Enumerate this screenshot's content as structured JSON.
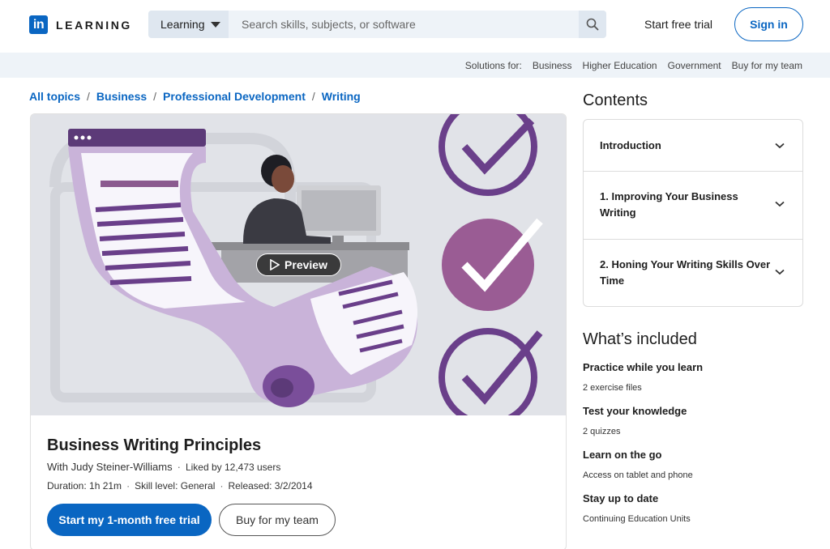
{
  "brand": {
    "logo_mark": "in",
    "logo_word": "LEARNING",
    "accent": "#0a66c2"
  },
  "search": {
    "category": "Learning",
    "placeholder": "Search skills, subjects, or software",
    "icon": "search-icon"
  },
  "header": {
    "start_trial": "Start free trial",
    "sign_in": "Sign in"
  },
  "solutions": {
    "label": "Solutions for:",
    "items": [
      "Business",
      "Higher Education",
      "Government",
      "Buy for my team"
    ]
  },
  "breadcrumb": [
    "All topics",
    "Business",
    "Professional Development",
    "Writing"
  ],
  "course": {
    "preview_label": "Preview",
    "title": "Business Writing Principles",
    "author": "With Judy Steiner-Williams",
    "likes": "Liked by 12,473 users",
    "duration": "Duration: 1h 21m",
    "skill": "Skill level: General",
    "released": "Released: 3/2/2014",
    "cta_primary": "Start my 1-month free trial",
    "cta_secondary": "Buy for my team"
  },
  "contents": {
    "title": "Contents",
    "chapters": [
      "Introduction",
      "1. Improving Your Business Writing",
      "2. Honing Your Writing Skills Over Time"
    ]
  },
  "included": {
    "title": "What’s included",
    "items": [
      {
        "heading": "Practice while you learn",
        "detail": "2 exercise files"
      },
      {
        "heading": "Test your knowledge",
        "detail": "2 quizzes"
      },
      {
        "heading": "Learn on the go",
        "detail": "Access on tablet and phone"
      },
      {
        "heading": "Stay up to date",
        "detail": "Continuing Education Units"
      }
    ]
  }
}
